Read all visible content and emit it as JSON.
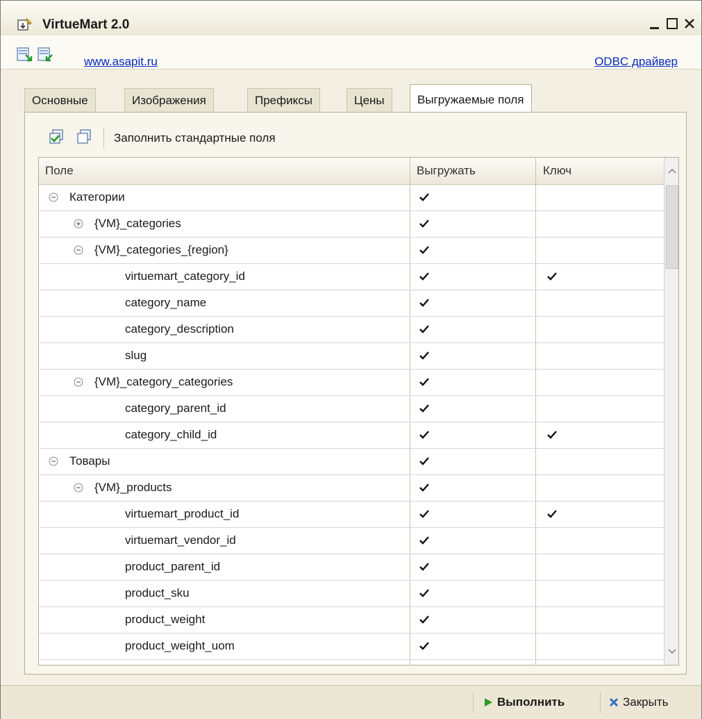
{
  "window": {
    "title": "VirtueMart 2.0"
  },
  "links": {
    "site": "www.asapit.ru",
    "odbc": "ODBC драйвер"
  },
  "tabs": [
    {
      "label": "Основные",
      "active": false
    },
    {
      "label": "Изображения",
      "active": false
    },
    {
      "label": "Префиксы",
      "active": false
    },
    {
      "label": "Цены",
      "active": false
    },
    {
      "label": "Выгружаемые поля",
      "active": true
    }
  ],
  "toolbar": {
    "fill_label": "Заполнить стандартные поля"
  },
  "grid": {
    "columns": [
      "Поле",
      "Выгружать",
      "Ключ"
    ],
    "rows": [
      {
        "name": "Категории",
        "level": 0,
        "toggle": "collapse",
        "export": true,
        "key": false
      },
      {
        "name": "{VM}_categories",
        "level": 1,
        "toggle": "expand",
        "export": true,
        "key": false
      },
      {
        "name": "{VM}_categories_{region}",
        "level": 1,
        "toggle": "collapse",
        "export": true,
        "key": false
      },
      {
        "name": "virtuemart_category_id",
        "level": 2,
        "toggle": "none",
        "export": true,
        "key": true
      },
      {
        "name": "category_name",
        "level": 2,
        "toggle": "none",
        "export": true,
        "key": false
      },
      {
        "name": "category_description",
        "level": 2,
        "toggle": "none",
        "export": true,
        "key": false
      },
      {
        "name": "slug",
        "level": 2,
        "toggle": "none",
        "export": true,
        "key": false
      },
      {
        "name": "{VM}_category_categories",
        "level": 1,
        "toggle": "collapse",
        "export": true,
        "key": false
      },
      {
        "name": "category_parent_id",
        "level": 2,
        "toggle": "none",
        "export": true,
        "key": false
      },
      {
        "name": "category_child_id",
        "level": 2,
        "toggle": "none",
        "export": true,
        "key": true
      },
      {
        "name": "Товары",
        "level": 0,
        "toggle": "collapse",
        "export": true,
        "key": false
      },
      {
        "name": "{VM}_products",
        "level": 1,
        "toggle": "collapse",
        "export": true,
        "key": false
      },
      {
        "name": "virtuemart_product_id",
        "level": 2,
        "toggle": "none",
        "export": true,
        "key": true
      },
      {
        "name": "virtuemart_vendor_id",
        "level": 2,
        "toggle": "none",
        "export": true,
        "key": false
      },
      {
        "name": "product_parent_id",
        "level": 2,
        "toggle": "none",
        "export": true,
        "key": false
      },
      {
        "name": "product_sku",
        "level": 2,
        "toggle": "none",
        "export": true,
        "key": false
      },
      {
        "name": "product_weight",
        "level": 2,
        "toggle": "none",
        "export": true,
        "key": false
      },
      {
        "name": "product_weight_uom",
        "level": 2,
        "toggle": "none",
        "export": true,
        "key": false
      }
    ]
  },
  "footer": {
    "run_label": "Выполнить",
    "close_label": "Закрыть"
  },
  "colors": {
    "link": "#0a2bb8",
    "run_arrow": "#2e9a1e",
    "close_x": "#3b6fc4"
  }
}
